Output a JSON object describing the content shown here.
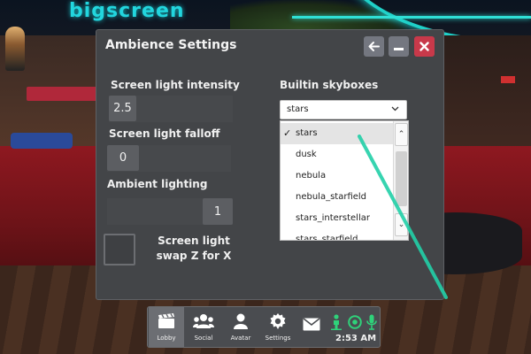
{
  "brand": {
    "logo_text": "bigscreen"
  },
  "window": {
    "title": "Ambience Settings",
    "buttons": {
      "back": "back-arrow-icon",
      "minimize": "minimize-icon",
      "close": "close-x-icon"
    }
  },
  "settings": {
    "screen_light_intensity": {
      "label": "Screen light intensity",
      "value": "2.5"
    },
    "screen_light_falloff": {
      "label": "Screen light falloff",
      "value": "0"
    },
    "ambient_lighting": {
      "label": "Ambient lighting",
      "value": "1"
    },
    "screen_light_swap": {
      "label": "Screen light swap Z for X",
      "checked": false
    },
    "builtin_skyboxes": {
      "label": "Builtin skyboxes",
      "selected": "stars",
      "options": [
        "stars",
        "dusk",
        "nebula",
        "nebula_starfield",
        "stars_interstellar",
        "stars_starfield"
      ]
    }
  },
  "taskbar": {
    "items": [
      {
        "label": "Lobby",
        "icon": "clapperboard-icon",
        "active": true
      },
      {
        "label": "Social",
        "icon": "people-icon",
        "active": false
      },
      {
        "label": "Avatar",
        "icon": "person-icon",
        "active": false
      },
      {
        "label": "Settings",
        "icon": "gear-icon",
        "active": false
      }
    ],
    "tray": [
      "envelope-icon",
      "person-stand-icon",
      "target-icon",
      "microphone-icon"
    ],
    "time": "2:53 AM"
  },
  "colors": {
    "accent": "#1fd0c8",
    "close_button": "#c8394a",
    "panel_bg": "#434548",
    "tray_green": "#2fd27a"
  }
}
